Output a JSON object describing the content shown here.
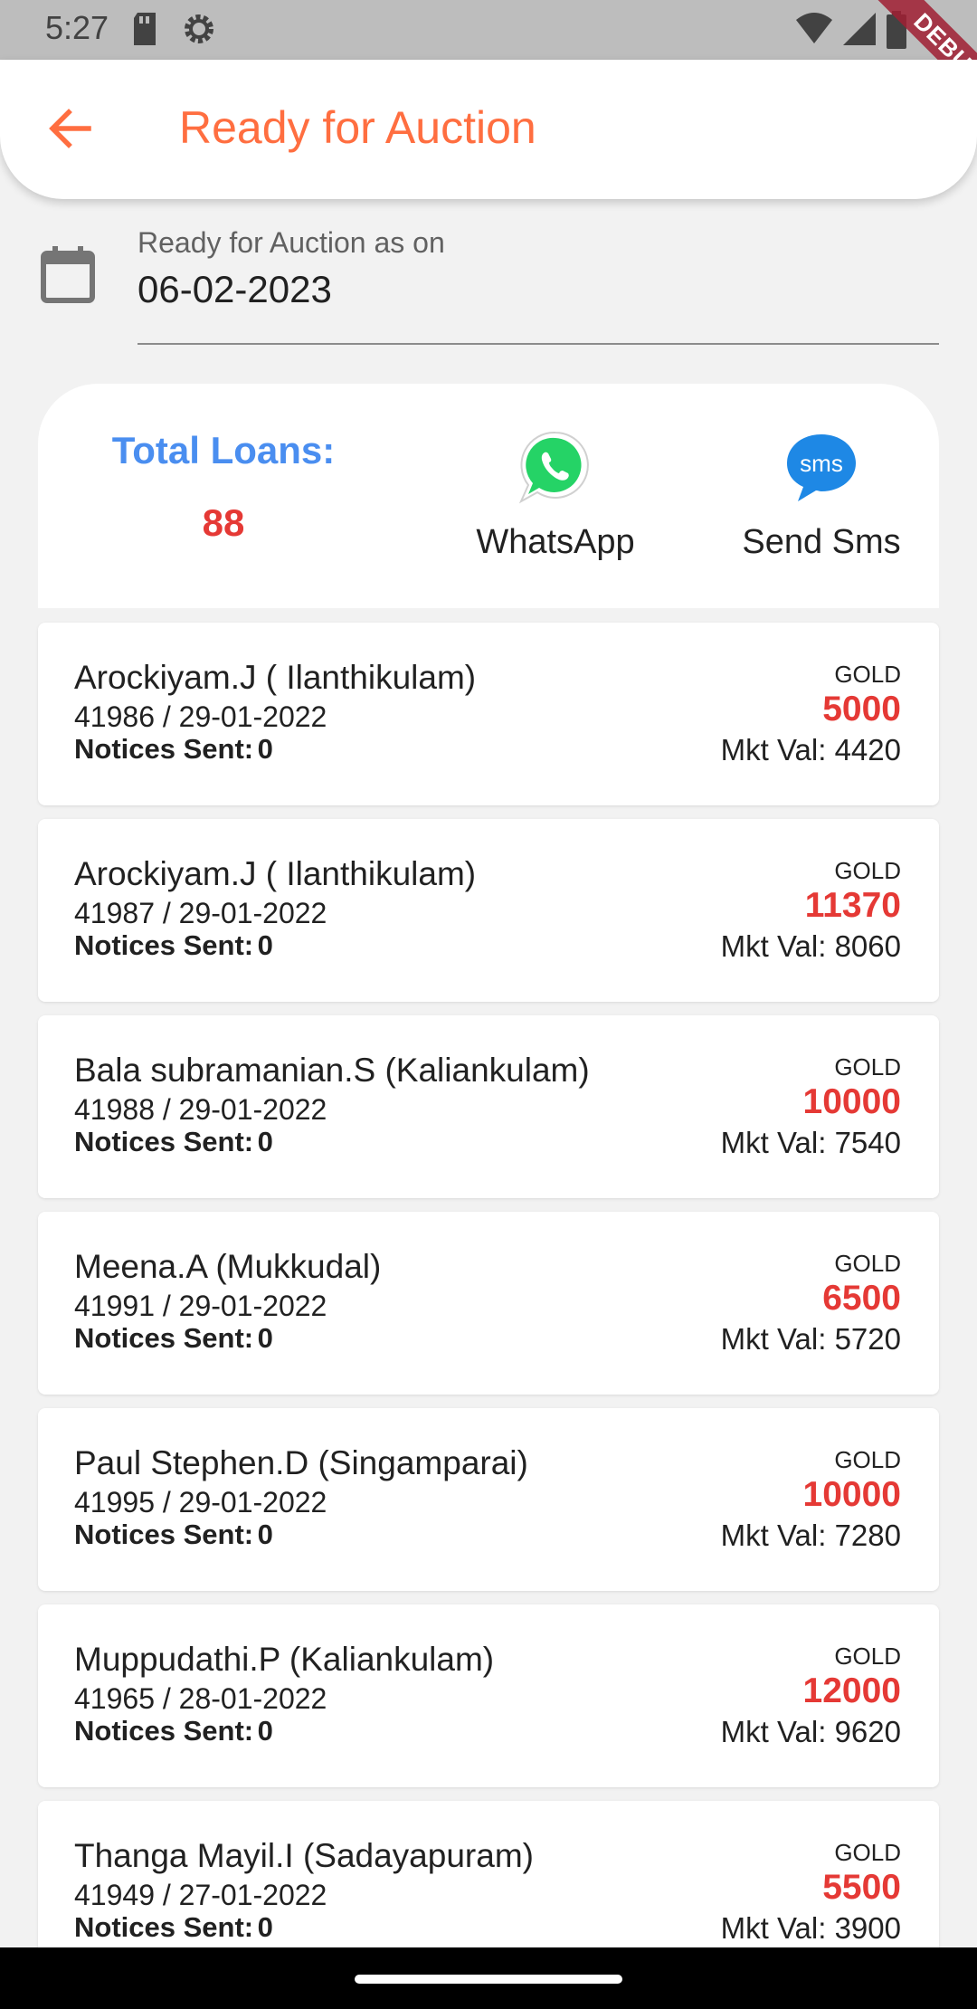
{
  "status_bar": {
    "time": "5:27",
    "debug_label": "DEBUG"
  },
  "app_bar": {
    "title": "Ready for Auction"
  },
  "date_field": {
    "label": "Ready for Auction as on",
    "value": "06-02-2023"
  },
  "summary": {
    "total_label": "Total Loans:",
    "total_value": "88",
    "whatsapp_label": "WhatsApp",
    "sms_label": "Send Sms",
    "sms_icon_text": "sms"
  },
  "colors": {
    "accent": "#ff6e40",
    "total_label": "#4a8ef0",
    "amount": "#e53935",
    "whatsapp": "#25d366",
    "sms": "#1e88e5"
  },
  "icons": {
    "back": "arrow-back-icon",
    "calendar": "calendar-icon",
    "whatsapp": "whatsapp-icon",
    "sms": "sms-icon"
  },
  "notices_label": "Notices Sent:",
  "mkt_label": "Mkt Val:",
  "loans": [
    {
      "name": "Arockiyam.J ( Ilanthikulam)",
      "ref": "41986 / 29-01-2022",
      "notices": "0",
      "type": "GOLD",
      "amount": "5000",
      "mkt_val": "4420"
    },
    {
      "name": "Arockiyam.J ( Ilanthikulam)",
      "ref": "41987 / 29-01-2022",
      "notices": "0",
      "type": "GOLD",
      "amount": "11370",
      "mkt_val": "8060"
    },
    {
      "name": "Bala subramanian.S (Kaliankulam)",
      "ref": "41988 / 29-01-2022",
      "notices": "0",
      "type": "GOLD",
      "amount": "10000",
      "mkt_val": "7540"
    },
    {
      "name": "Meena.A (Mukkudal)",
      "ref": "41991 / 29-01-2022",
      "notices": "0",
      "type": "GOLD",
      "amount": "6500",
      "mkt_val": "5720"
    },
    {
      "name": "Paul Stephen.D (Singamparai)",
      "ref": "41995 / 29-01-2022",
      "notices": "0",
      "type": "GOLD",
      "amount": "10000",
      "mkt_val": "7280"
    },
    {
      "name": "Muppudathi.P (Kaliankulam)",
      "ref": "41965 / 28-01-2022",
      "notices": "0",
      "type": "GOLD",
      "amount": "12000",
      "mkt_val": "9620"
    },
    {
      "name": "Thanga Mayil.I (Sadayapuram)",
      "ref": "41949 / 27-01-2022",
      "notices": "0",
      "type": "GOLD",
      "amount": "5500",
      "mkt_val": "3900"
    }
  ]
}
